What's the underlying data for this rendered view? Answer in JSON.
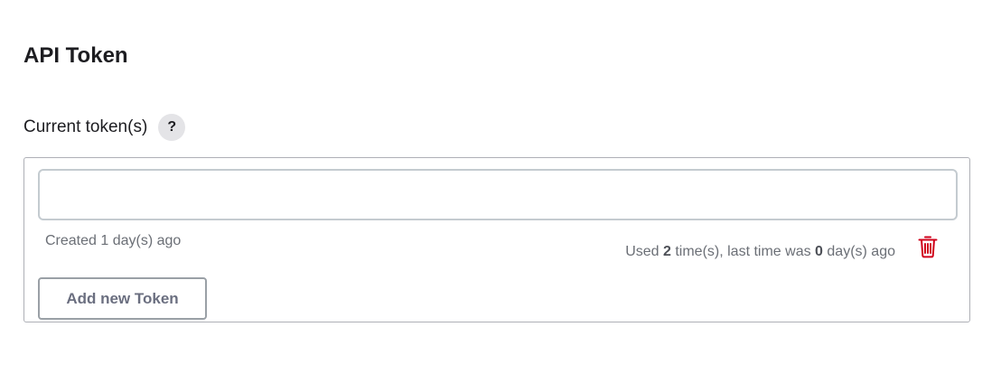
{
  "section": {
    "title": "API Token"
  },
  "tokens": {
    "label": "Current token(s)",
    "help_label": "?",
    "items": [
      {
        "name_value": "",
        "created_prefix": "Created ",
        "created_days": "1",
        "created_suffix": " day(s) ago",
        "used_prefix": "Used ",
        "used_count": "2",
        "used_middle": " time(s), last time was ",
        "last_used_days": "0",
        "used_suffix": " day(s) ago",
        "delete_icon": "trash-icon",
        "delete_color": "#d0021b"
      }
    ],
    "add_button_label": "Add new Token"
  }
}
